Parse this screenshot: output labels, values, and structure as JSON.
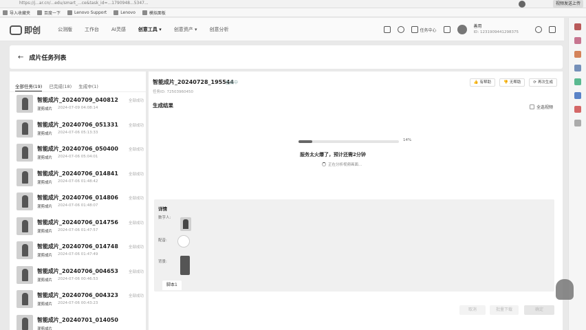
{
  "browser": {
    "url": "https://j...ar.cn/...edu/smart_...ce&task_id=...1790948...5347...",
    "bookmarks": [
      "导入收藏夹",
      "百度一下",
      "Lenovo Support",
      "Lenovo",
      "模拟面板"
    ],
    "extension_label": "视频发送上传"
  },
  "header": {
    "logo_text": "即创",
    "nav": [
      "公测版",
      "工作台",
      "AI灵感",
      "创意工具 ▾",
      "创意资产 ▾",
      "创意分析"
    ],
    "task_center": "任务中心",
    "user_name": "善用",
    "user_id": "ID: 1231909441298375"
  },
  "page": {
    "title": "成片任务列表",
    "back_icon": "back-arrow-icon"
  },
  "tabs": [
    "全部任务(19)",
    "已完成(18)",
    "生成中(1)"
  ],
  "tasks": [
    {
      "name": "智能成片_20240709_040812",
      "type": "混剪成片",
      "date": "2024-07-09 04:08:14",
      "status": "全部成功"
    },
    {
      "name": "智能成片_20240706_051331",
      "type": "混剪成片",
      "date": "2024-07-06 05:13:33",
      "status": "全部成功"
    },
    {
      "name": "智能成片_20240706_050400",
      "type": "混剪成片",
      "date": "2024-07-06 05:04:01",
      "status": "全部成功"
    },
    {
      "name": "智能成片_20240706_014841",
      "type": "混剪成片",
      "date": "2024-07-06 01:48:42",
      "status": "全部成功"
    },
    {
      "name": "智能成片_20240706_014806",
      "type": "混剪成片",
      "date": "2024-07-06 01:48:07",
      "status": "全部成功"
    },
    {
      "name": "智能成片_20240706_014756",
      "type": "混剪成片",
      "date": "2024-07-06 01:47:57",
      "status": "全部成功"
    },
    {
      "name": "智能成片_20240706_014748",
      "type": "混剪成片",
      "date": "2024-07-06 01:47:49",
      "status": "全部成功"
    },
    {
      "name": "智能成片_20240706_004653",
      "type": "混剪成片",
      "date": "2024-07-06 00:46:53",
      "status": "全部成功"
    },
    {
      "name": "智能成片_20240706_004323",
      "type": "混剪成片",
      "date": "2024-07-06 00:43:23",
      "status": "全部成功"
    },
    {
      "name": "智能成片_20240701_014050",
      "type": "混剪成片",
      "date": "",
      "status": ""
    }
  ],
  "main": {
    "title": "智能成片_20240728_195544",
    "status": "生成中",
    "task_id": "任务ID: 72503960450",
    "btn_helpful": "有帮助",
    "btn_unhelpful": "无帮助",
    "btn_regenerate": "再次生成",
    "section_title": "生成结果",
    "select_all": "全选视频",
    "progress_percent": 14,
    "progress_label": "14%",
    "progress_msg": "服务太火爆了，预计还需2分钟",
    "progress_sub": "正在分析视频画面..."
  },
  "detail": {
    "title": "详情",
    "labels": [
      "数字人:",
      "配音:",
      "背景:"
    ],
    "script_tab": "脚本1"
  },
  "footer": {
    "cancel": "取消",
    "download": "批量下载",
    "confirm": "确定"
  }
}
